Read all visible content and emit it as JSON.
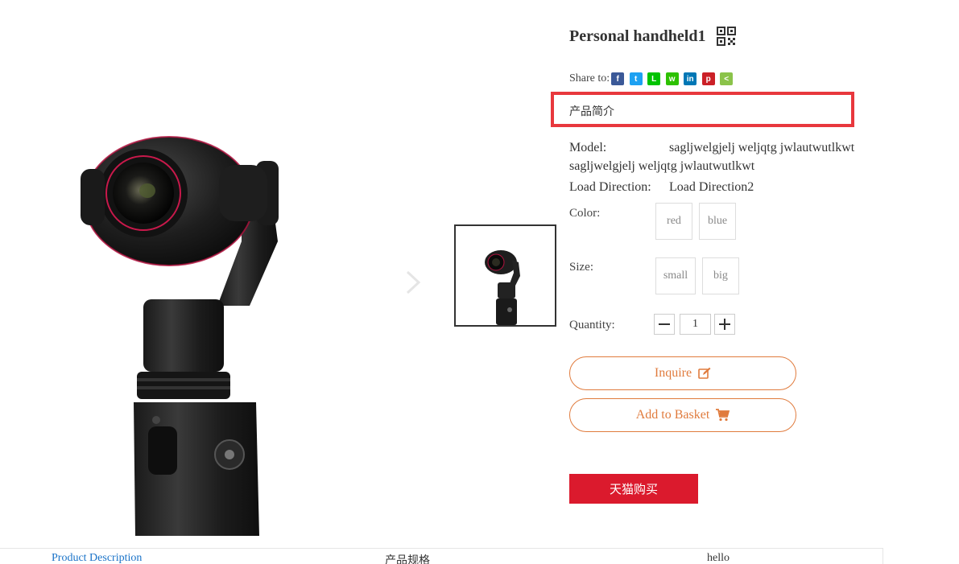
{
  "product": {
    "title": "Personal handheld1",
    "share_label": "Share to:",
    "intro_label": "产品简介",
    "model_label": "Model:",
    "model_value": "sagljwelgjelj weljqtg jwlautwutlkwt sagljwelgjelj weljqtg jwlautwutlkwt",
    "load_label": "Load Direction:",
    "load_value": "Load Direction2",
    "color_label": "Color:",
    "color_options": [
      "red",
      "blue"
    ],
    "size_label": "Size:",
    "size_options": [
      "small",
      "big"
    ],
    "quantity_label": "Quantity:",
    "quantity_value": "1"
  },
  "share_icons": [
    {
      "name": "facebook-icon",
      "glyph": "f",
      "color": "#3b5998"
    },
    {
      "name": "twitter-icon",
      "glyph": "t",
      "color": "#1da1f2"
    },
    {
      "name": "line-icon",
      "glyph": "L",
      "color": "#00c300"
    },
    {
      "name": "wechat-icon",
      "glyph": "w",
      "color": "#2dc100"
    },
    {
      "name": "linkedin-icon",
      "glyph": "in",
      "color": "#0077b5"
    },
    {
      "name": "pinterest-icon",
      "glyph": "p",
      "color": "#cb2027"
    },
    {
      "name": "share-icon",
      "glyph": "<",
      "color": "#8bc34a"
    }
  ],
  "actions": {
    "inquire_label": "Inquire",
    "add_basket_label": "Add to Basket",
    "tmall_label": "天猫购买"
  },
  "tabs": [
    "Product Description",
    "产品规格",
    "hello"
  ],
  "colors": {
    "accent_orange": "#e07b3d",
    "tmall_red": "#db1a2d",
    "highlight_red": "#e8383d",
    "tab_active": "#1a73c8"
  }
}
